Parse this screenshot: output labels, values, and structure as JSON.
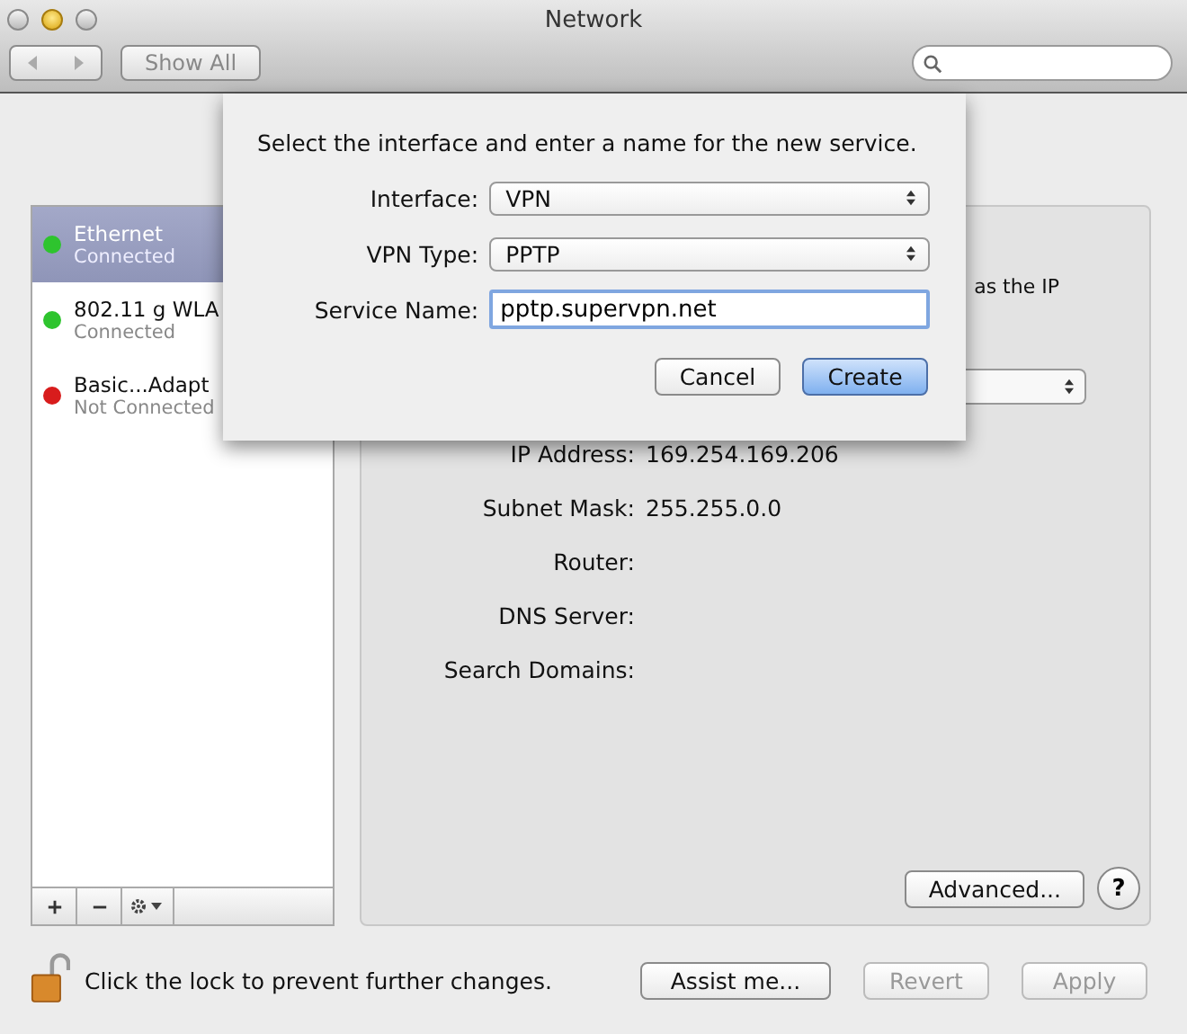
{
  "window": {
    "title": "Network"
  },
  "toolbar": {
    "show_all": "Show All"
  },
  "services": [
    {
      "name": "Ethernet",
      "status": "Connected",
      "color": "#2ec42e",
      "selected": true
    },
    {
      "name": "802.11 g WLA",
      "status": "Connected",
      "color": "#2ec42e",
      "selected": false
    },
    {
      "name": "Basic...Adapt",
      "status": "Not Connected",
      "color": "#d81c1c",
      "selected": false
    }
  ],
  "detail": {
    "status_fragment": "as the IP",
    "fields": [
      {
        "label": "IP Address:",
        "value": "169.254.169.206"
      },
      {
        "label": "Subnet Mask:",
        "value": "255.255.0.0"
      },
      {
        "label": "Router:"
      },
      {
        "label": "DNS Server:"
      },
      {
        "label": "Search Domains:"
      }
    ],
    "advanced": "Advanced...",
    "help": "?"
  },
  "sheet": {
    "prompt": "Select the interface and enter a name for the new service.",
    "interface": {
      "label": "Interface:",
      "value": "VPN"
    },
    "vpn_type": {
      "label": "VPN Type:",
      "value": "PPTP"
    },
    "service_name": {
      "label": "Service Name:",
      "value": "pptp.supervpn.net"
    },
    "buttons": [
      {
        "label": "Cancel",
        "default": false
      },
      {
        "label": "Create",
        "default": true
      }
    ]
  },
  "footer": {
    "lock_text": "Click the lock to prevent further changes.",
    "buttons": [
      {
        "label": "Assist me...",
        "disabled": false
      },
      {
        "label": "Revert",
        "disabled": true
      },
      {
        "label": "Apply",
        "disabled": true
      }
    ]
  }
}
